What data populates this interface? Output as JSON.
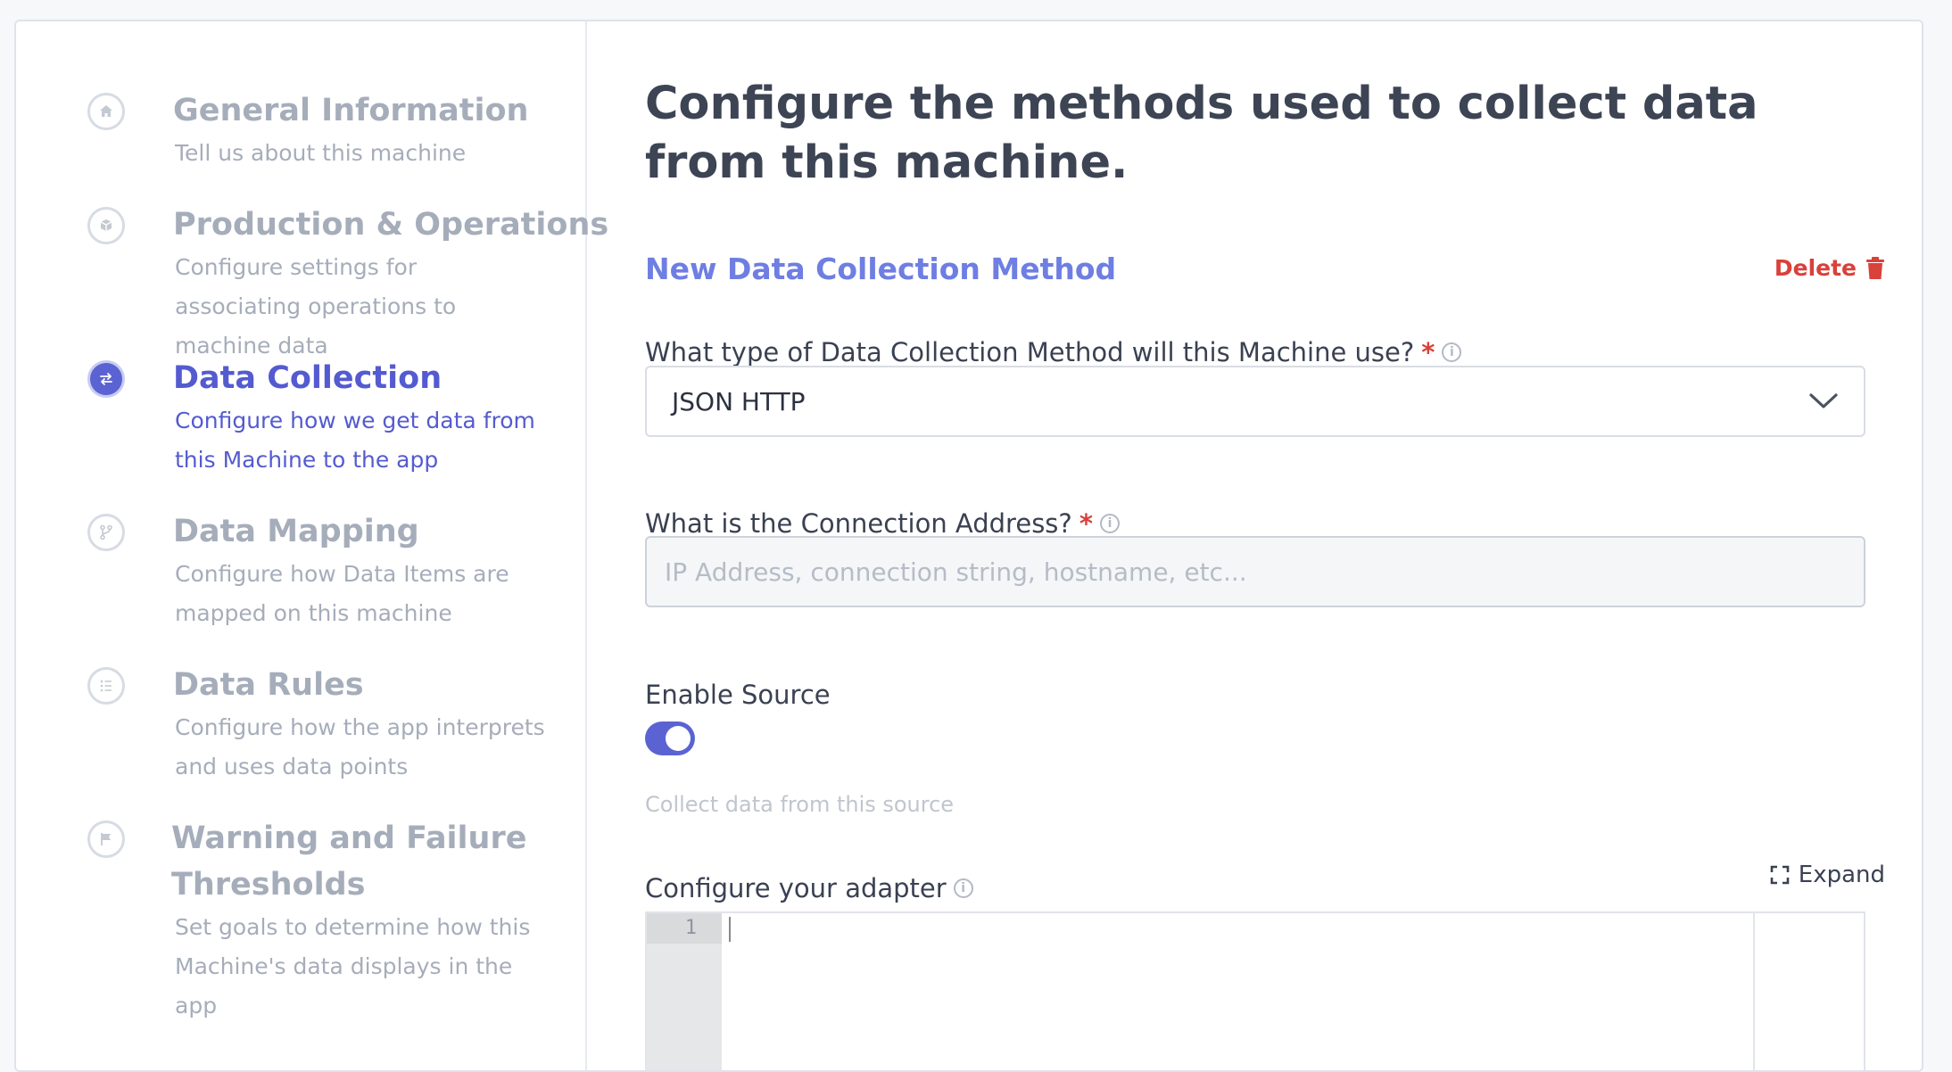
{
  "steps": [
    {
      "title": "General Information",
      "desc": "Tell us about this machine",
      "icon": "home-icon"
    },
    {
      "title": "Production & Operations",
      "desc": "Configure settings for associating operations to machine data",
      "icon": "box-icon"
    },
    {
      "title": "Data Collection",
      "desc": "Configure how we get data from this Machine to the app",
      "icon": "swap-icon"
    },
    {
      "title": "Data Mapping",
      "desc": "Configure how Data Items are mapped on this machine",
      "icon": "branch-icon"
    },
    {
      "title": "Data Rules",
      "desc": "Configure how the app interprets and uses data points",
      "icon": "list-icon"
    },
    {
      "title": "Warning and Failure Thresholds",
      "desc": "Set goals to determine how this Machine's data displays in the app",
      "icon": "flag-icon"
    }
  ],
  "main": {
    "title": "Configure the methods used to collect data from this machine.",
    "section_title": "New Data Collection Method",
    "delete_label": "Delete",
    "method_label": "What type of Data Collection Method will this Machine use?",
    "method_value": "JSON HTTP",
    "address_label": "What is the Connection Address?",
    "address_placeholder": "IP Address, connection string, hostname, etc...",
    "address_value": "",
    "required_mark": "*",
    "enable_label": "Enable Source",
    "enable_on": true,
    "enable_hint": "Collect data from this source",
    "adapter_label": "Configure your adapter",
    "expand_label": "Expand",
    "editor_line": "1"
  },
  "colors": {
    "accent": "#5b63d3",
    "section": "#6e7ee3",
    "danger": "#d9413b",
    "muted": "#a6adba"
  }
}
